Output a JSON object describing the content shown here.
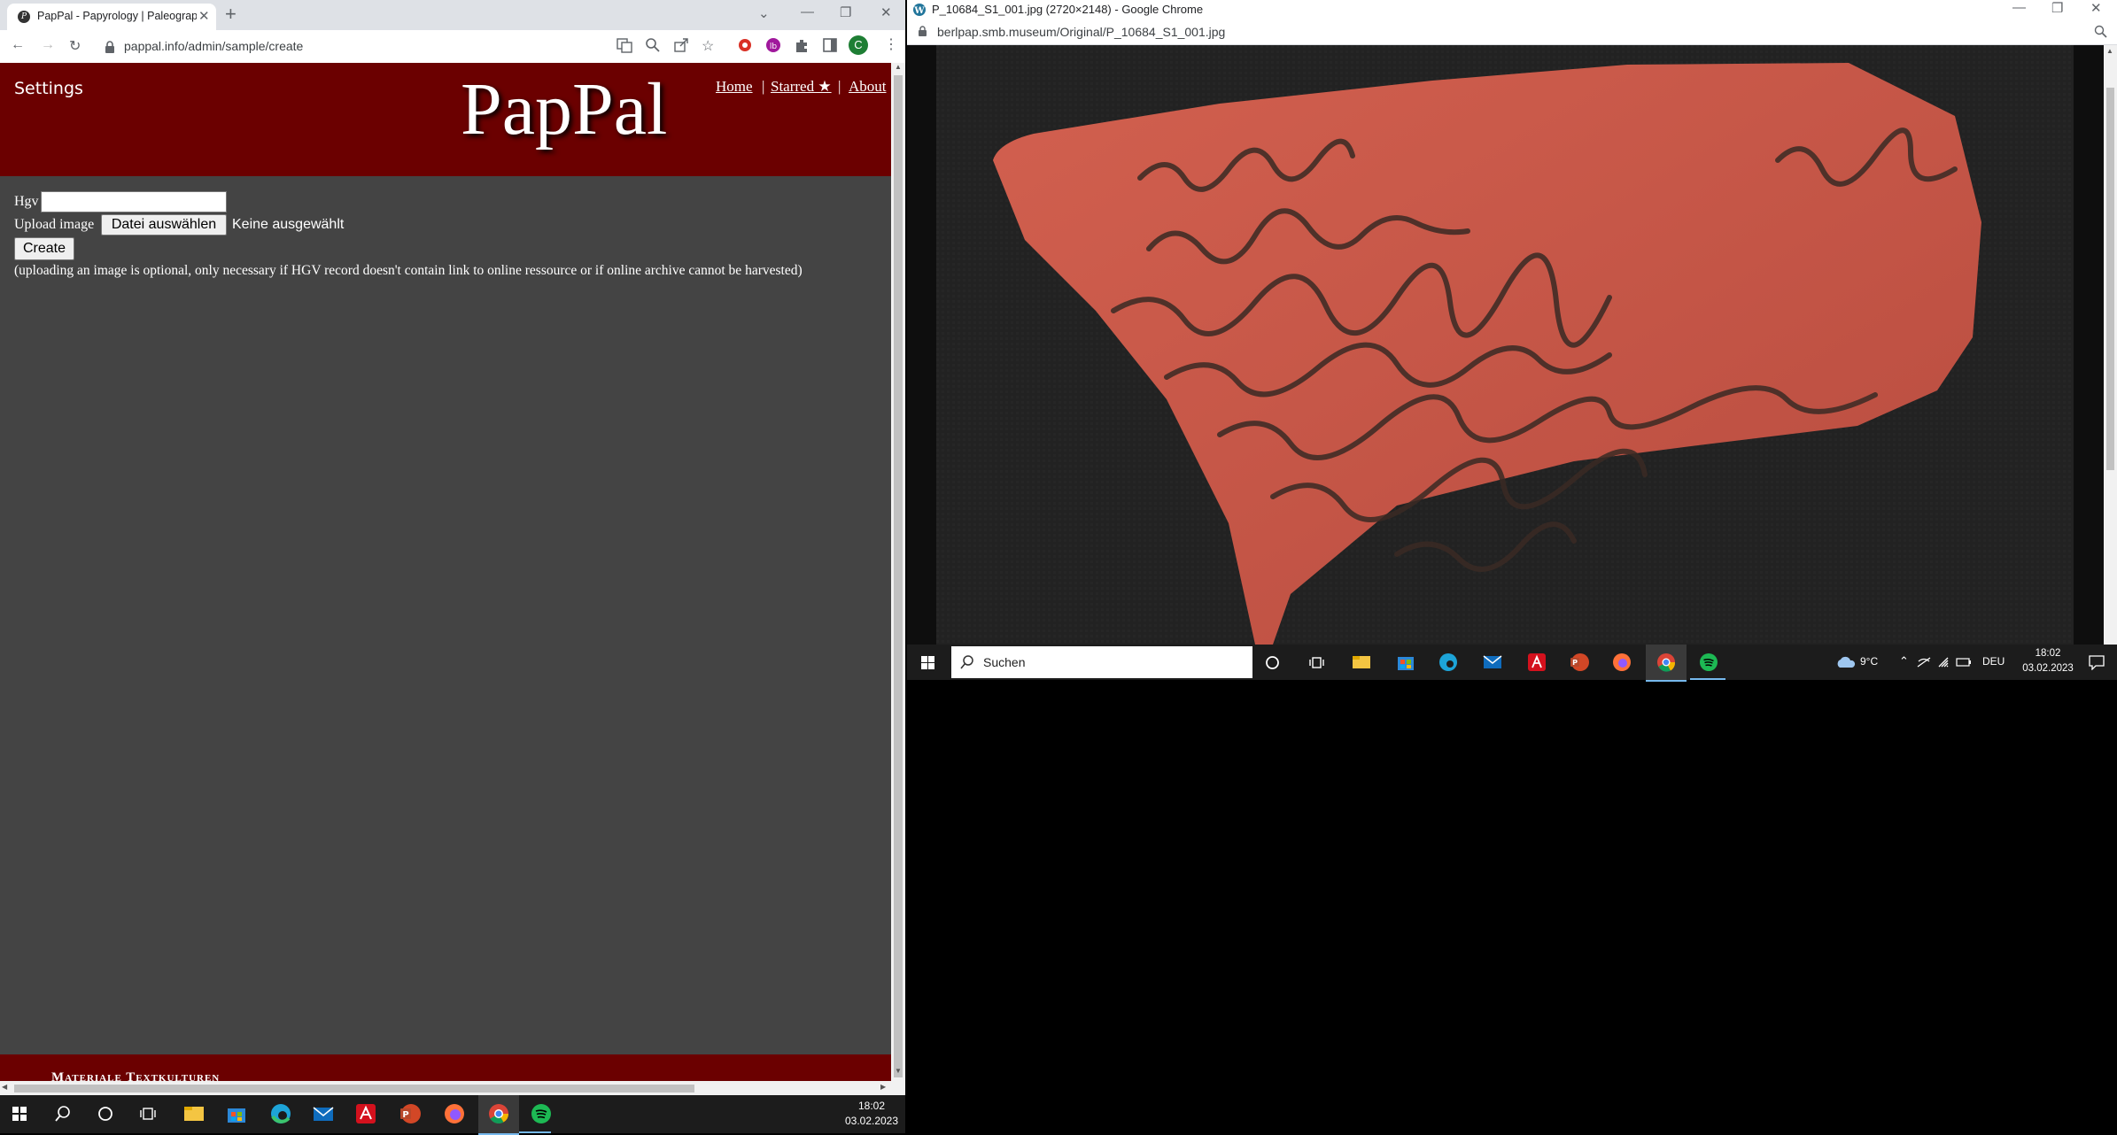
{
  "left_browser": {
    "tab_title": "PapPal - Papyrology | Paleography",
    "url": "pappal.info/admin/sample/create",
    "profile_initial": "C"
  },
  "pappal": {
    "settings": "Settings",
    "logo": "PapPal",
    "nav": [
      {
        "label": "Home"
      },
      {
        "label": "Starred ★"
      },
      {
        "label": "About"
      }
    ],
    "nav_separator": "|",
    "hgv_label": "Hgv",
    "upload_label": "Upload image",
    "file_button": "Datei auswählen",
    "file_status": "Keine ausgewählt",
    "create_button": "Create",
    "note": "(uploading an image is optional, only necessary if HGV record doesn't contain link to online ressource or if online archive cannot be harvested)",
    "footer_text": "Materiale Textkulturen"
  },
  "right_browser": {
    "window_title": "P_10684_S1_001.jpg (2720×2148) - Google Chrome",
    "url": "berlpap.smb.museum/Original/P_10684_S1_001.jpg"
  },
  "taskbar_right": {
    "search_placeholder": "Suchen",
    "temperature": "9°C",
    "language": "DEU",
    "time": "18:02",
    "date": "03.02.2023"
  },
  "taskbar_left": {
    "time": "18:02",
    "date": "03.02.2023"
  },
  "colors": {
    "pappal_red": "#6b0000",
    "page_bg": "#444444",
    "sherd": "#c8584a"
  },
  "icons": [
    "windows-start-icon",
    "search-icon",
    "cortana-icon",
    "task-view-icon",
    "file-explorer-icon",
    "store-icon",
    "edge-icon",
    "mail-icon",
    "acrobat-icon",
    "powerpoint-icon",
    "firefox-icon",
    "chrome-icon",
    "spotify-icon"
  ]
}
